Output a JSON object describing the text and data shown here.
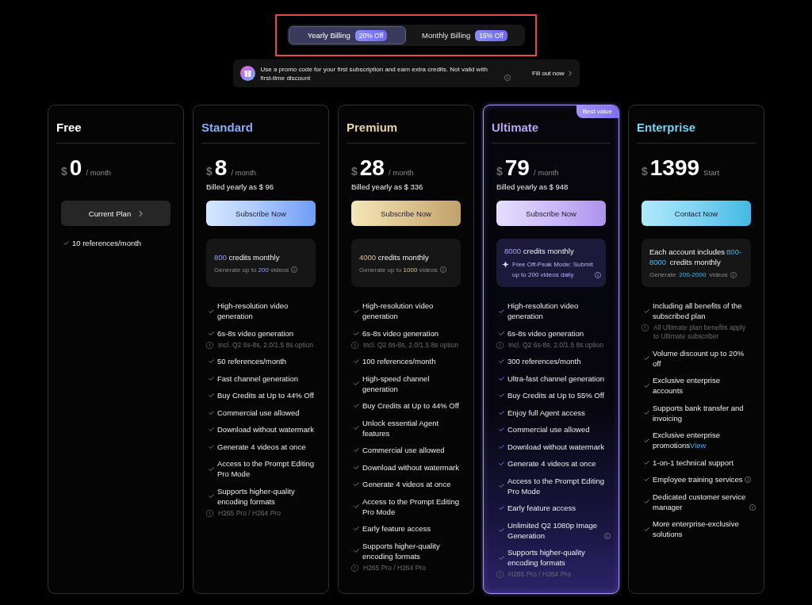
{
  "billing_toggle": {
    "highlighted": true,
    "options": [
      {
        "label": "Yearly Billing",
        "badge": "20% Off",
        "selected": true
      },
      {
        "label": "Monthly Billing",
        "badge": "15% Off",
        "selected": false
      }
    ]
  },
  "promo_banner": {
    "text": "Use a promo code for your first subscription and earn extra credits. Not valid with first-time discount",
    "info": true,
    "link": "Fill out now"
  },
  "plans": [
    {
      "name": "Free",
      "kind": "free",
      "featured": false,
      "currency": "$",
      "price": "0",
      "period": "/ month",
      "button": {
        "label": "Current Plan",
        "kind": "current"
      },
      "features": [
        {
          "text": "10 references/month"
        }
      ]
    },
    {
      "name": "Standard",
      "kind": "standard",
      "featured": false,
      "currency": "$",
      "price": "8",
      "period": "/ month",
      "billed": "Billed yearly as $ 96",
      "button": {
        "label": "Subscribe Now",
        "kind": "subscribe"
      },
      "credits": {
        "amount": "800",
        "suffix": "credits monthly",
        "detail": {
          "prefix": "Generate up to",
          "amount": "200",
          "suffix": "videos",
          "info": true
        }
      },
      "features": [
        {
          "text": "High-resolution video generation"
        },
        {
          "text": "6s-8s video generation",
          "note": "Incl. Q2 6s-8s, 2.0/1.5 8s option"
        },
        {
          "text": "50 references/month"
        },
        {
          "text": "Fast channel generation"
        },
        {
          "text": "Buy Credits at Up to 44% Off"
        },
        {
          "text": "Commercial use allowed"
        },
        {
          "text": "Download without watermark"
        },
        {
          "text": "Generate 4 videos at once"
        },
        {
          "text": "Access to the Prompt Editing Pro Mode"
        },
        {
          "text": "Supports higher-quality encoding formats",
          "note": "H265 Pro / H264 Pro"
        }
      ]
    },
    {
      "name": "Premium",
      "kind": "premium",
      "featured": false,
      "currency": "$",
      "price": "28",
      "period": "/ month",
      "billed": "Billed yearly as $ 336",
      "button": {
        "label": "Subscribe Now",
        "kind": "subscribe"
      },
      "credits": {
        "amount": "4000",
        "suffix": "credits monthly",
        "detail": {
          "prefix": "Generate up to",
          "amount": "1000",
          "suffix": "videos",
          "info": true
        }
      },
      "features": [
        {
          "text": "High-resolution video generation"
        },
        {
          "text": "6s-8s video generation",
          "note": "Incl. Q2 6s-8s, 2.0/1.5 8s option"
        },
        {
          "text": "100 references/month"
        },
        {
          "text": "High-speed channel generation"
        },
        {
          "text": "Buy Credits at Up to 44% Off"
        },
        {
          "text": "Unlock essential Agent features"
        },
        {
          "text": "Commercial use allowed"
        },
        {
          "text": "Download without watermark"
        },
        {
          "text": "Generate 4 videos at once"
        },
        {
          "text": "Access to the Prompt Editing Pro Mode"
        },
        {
          "text": "Early feature access"
        },
        {
          "text": "Supports higher-quality encoding formats",
          "note": "H265 Pro / H264 Pro"
        }
      ]
    },
    {
      "name": "Ultimate",
      "kind": "ultimate",
      "featured": true,
      "badge": "Best value",
      "currency": "$",
      "price": "79",
      "period": "/ month",
      "billed": "Billed yearly as $ 948",
      "button": {
        "label": "Subscribe Now",
        "kind": "subscribe"
      },
      "credits": {
        "amount": "8000",
        "suffix": "credits monthly",
        "perk": {
          "text": "Free Off-Peak Mode: Submit up to 200 videos daily",
          "info": true
        }
      },
      "features": [
        {
          "text": "High-resolution video generation"
        },
        {
          "text": "6s-8s video generation",
          "note": "Incl. Q2 6s-8s, 2.0/1.5 8s option"
        },
        {
          "text": "300 references/month"
        },
        {
          "text": "Ultra-fast channel generation"
        },
        {
          "text": "Buy Credits at Up to 55% Off"
        },
        {
          "text": "Enjoy full Agent access"
        },
        {
          "text": "Commercial use allowed"
        },
        {
          "text": "Download without watermark"
        },
        {
          "text": "Generate 4 videos at once"
        },
        {
          "text": "Access to the Prompt Editing Pro Mode"
        },
        {
          "text": "Early feature access"
        },
        {
          "text": "Unlimited Q2 1080p Image Generation",
          "info": true
        },
        {
          "text": "Supports higher-quality encoding formats",
          "note": "H265 Pro / H264 Pro"
        }
      ]
    },
    {
      "name": "Enterprise",
      "kind": "enterprise",
      "featured": false,
      "currency": "$",
      "price": "1399",
      "period": "Start",
      "button": {
        "label": "Contact Now",
        "kind": "contact"
      },
      "credits": {
        "prefix": "Each account includes",
        "amount": "800-8000",
        "suffix": "credits monthly",
        "detail": {
          "prefix": "Generate",
          "amount": "200-2000",
          "suffix": "videos",
          "info": true
        }
      },
      "features": [
        {
          "text": "Including all benefits of the subscribed plan",
          "note": "All Ultimate plan benefits apply to Ultimate subscriber"
        },
        {
          "text": "Volume discount up to 20% off"
        },
        {
          "text": "Exclusive enterprise accounts"
        },
        {
          "text": "Supports bank transfer and invoicing"
        },
        {
          "text": "Exclusive enterprise promotions",
          "link": "View"
        },
        {
          "text": "1-on-1 technical support"
        },
        {
          "text": "Employee training services",
          "info": true
        },
        {
          "text": "Dedicated customer service manager",
          "info": true
        },
        {
          "text": "More enterprise-exclusive solutions"
        }
      ]
    }
  ]
}
